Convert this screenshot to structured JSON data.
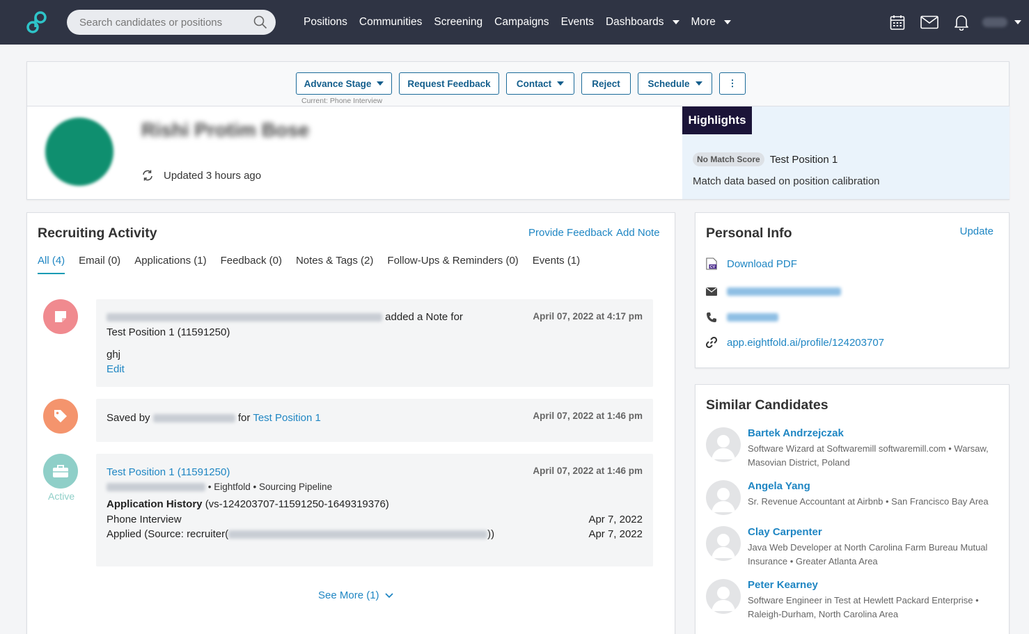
{
  "nav": {
    "search_placeholder": "Search candidates or positions",
    "links": [
      "Positions",
      "Communities",
      "Screening",
      "Campaigns",
      "Events",
      "Dashboards",
      "More"
    ],
    "icons": [
      "calendar-icon",
      "mail-icon",
      "bell-icon"
    ]
  },
  "actions": {
    "advance_stage": "Advance Stage",
    "request_feedback": "Request Feedback",
    "contact": "Contact",
    "reject": "Reject",
    "schedule": "Schedule",
    "more": "⋮",
    "current_stage": "Current: Phone Interview"
  },
  "profile": {
    "name": "Rishi Protim Bose",
    "updated": "Updated 3 hours ago"
  },
  "highlights": {
    "tag": "Highlights",
    "badge": "No Match Score",
    "position": "Test Position 1",
    "note": "Match data based on position calibration"
  },
  "activity": {
    "title": "Recruiting Activity",
    "provide_feedback": "Provide Feedback",
    "add_note": "Add Note",
    "tabs": [
      "All (4)",
      "Email (0)",
      "Applications (1)",
      "Feedback (0)",
      "Notes & Tags (2)",
      "Follow-Ups & Reminders (0)",
      "Events (1)"
    ],
    "events": [
      {
        "action": "added a Note for",
        "position": "Test Position 1 (11591250)",
        "note": "ghj",
        "edit": "Edit",
        "date": "April 07, 2022 at 4:17 pm"
      },
      {
        "prefix": "Saved by",
        "mid": "for",
        "position": "Test Position 1",
        "date": "April 07, 2022 at 1:46 pm"
      },
      {
        "status": "Active",
        "position": "Test Position 1 (11591250)",
        "meta": "• Eightfold • Sourcing Pipeline",
        "history_label": "Application History",
        "history_id": "(vs-124203707-11591250-1649319376)",
        "stage1": "Phone Interview",
        "stage1_date": "Apr 7, 2022",
        "stage2": "Applied (Source: recruiter(",
        "stage2_end": "))",
        "stage2_date": "Apr 7, 2022",
        "date": "April 07, 2022 at 1:46 pm"
      }
    ],
    "see_more": "See More (1)"
  },
  "personal_info": {
    "title": "Personal Info",
    "update": "Update",
    "download": "Download PDF",
    "profile_url": "app.eightfold.ai/profile/124203707"
  },
  "similar": {
    "title": "Similar Candidates",
    "candidates": [
      {
        "name": "Bartek Andrzejczak",
        "desc": "Software Wizard at Softwaremill softwaremill.com • Warsaw, Masovian District, Poland"
      },
      {
        "name": "Angela Yang",
        "desc": "Sr. Revenue Accountant at Airbnb • San Francisco Bay Area"
      },
      {
        "name": "Clay Carpenter",
        "desc": "Java Web Developer at North Carolina Farm Bureau Mutual Insurance • Greater Atlanta Area"
      },
      {
        "name": "Peter Kearney",
        "desc": "Software Engineer in Test at Hewlett Packard Enterprise • Raleigh-Durham, North Carolina Area"
      }
    ]
  },
  "colors": {
    "nav_bg": "#2f3444",
    "accent": "#1f86c3",
    "highlight_tag": "#1b1438",
    "note_icon": "#f08a8f",
    "tag_icon": "#f4946d",
    "app_icon": "#8fcfc8"
  }
}
